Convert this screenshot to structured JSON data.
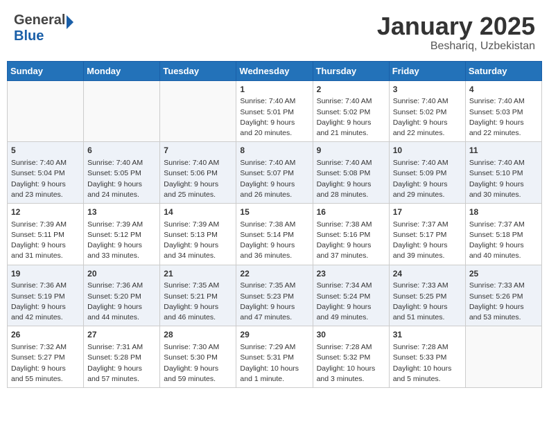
{
  "header": {
    "logo_general": "General",
    "logo_blue": "Blue",
    "month_title": "January 2025",
    "location": "Beshariq, Uzbekistan"
  },
  "calendar": {
    "weekdays": [
      "Sunday",
      "Monday",
      "Tuesday",
      "Wednesday",
      "Thursday",
      "Friday",
      "Saturday"
    ],
    "weeks": [
      [
        {
          "day": "",
          "info": ""
        },
        {
          "day": "",
          "info": ""
        },
        {
          "day": "",
          "info": ""
        },
        {
          "day": "1",
          "info": "Sunrise: 7:40 AM\nSunset: 5:01 PM\nDaylight: 9 hours\nand 20 minutes."
        },
        {
          "day": "2",
          "info": "Sunrise: 7:40 AM\nSunset: 5:02 PM\nDaylight: 9 hours\nand 21 minutes."
        },
        {
          "day": "3",
          "info": "Sunrise: 7:40 AM\nSunset: 5:02 PM\nDaylight: 9 hours\nand 22 minutes."
        },
        {
          "day": "4",
          "info": "Sunrise: 7:40 AM\nSunset: 5:03 PM\nDaylight: 9 hours\nand 22 minutes."
        }
      ],
      [
        {
          "day": "5",
          "info": "Sunrise: 7:40 AM\nSunset: 5:04 PM\nDaylight: 9 hours\nand 23 minutes."
        },
        {
          "day": "6",
          "info": "Sunrise: 7:40 AM\nSunset: 5:05 PM\nDaylight: 9 hours\nand 24 minutes."
        },
        {
          "day": "7",
          "info": "Sunrise: 7:40 AM\nSunset: 5:06 PM\nDaylight: 9 hours\nand 25 minutes."
        },
        {
          "day": "8",
          "info": "Sunrise: 7:40 AM\nSunset: 5:07 PM\nDaylight: 9 hours\nand 26 minutes."
        },
        {
          "day": "9",
          "info": "Sunrise: 7:40 AM\nSunset: 5:08 PM\nDaylight: 9 hours\nand 28 minutes."
        },
        {
          "day": "10",
          "info": "Sunrise: 7:40 AM\nSunset: 5:09 PM\nDaylight: 9 hours\nand 29 minutes."
        },
        {
          "day": "11",
          "info": "Sunrise: 7:40 AM\nSunset: 5:10 PM\nDaylight: 9 hours\nand 30 minutes."
        }
      ],
      [
        {
          "day": "12",
          "info": "Sunrise: 7:39 AM\nSunset: 5:11 PM\nDaylight: 9 hours\nand 31 minutes."
        },
        {
          "day": "13",
          "info": "Sunrise: 7:39 AM\nSunset: 5:12 PM\nDaylight: 9 hours\nand 33 minutes."
        },
        {
          "day": "14",
          "info": "Sunrise: 7:39 AM\nSunset: 5:13 PM\nDaylight: 9 hours\nand 34 minutes."
        },
        {
          "day": "15",
          "info": "Sunrise: 7:38 AM\nSunset: 5:14 PM\nDaylight: 9 hours\nand 36 minutes."
        },
        {
          "day": "16",
          "info": "Sunrise: 7:38 AM\nSunset: 5:16 PM\nDaylight: 9 hours\nand 37 minutes."
        },
        {
          "day": "17",
          "info": "Sunrise: 7:37 AM\nSunset: 5:17 PM\nDaylight: 9 hours\nand 39 minutes."
        },
        {
          "day": "18",
          "info": "Sunrise: 7:37 AM\nSunset: 5:18 PM\nDaylight: 9 hours\nand 40 minutes."
        }
      ],
      [
        {
          "day": "19",
          "info": "Sunrise: 7:36 AM\nSunset: 5:19 PM\nDaylight: 9 hours\nand 42 minutes."
        },
        {
          "day": "20",
          "info": "Sunrise: 7:36 AM\nSunset: 5:20 PM\nDaylight: 9 hours\nand 44 minutes."
        },
        {
          "day": "21",
          "info": "Sunrise: 7:35 AM\nSunset: 5:21 PM\nDaylight: 9 hours\nand 46 minutes."
        },
        {
          "day": "22",
          "info": "Sunrise: 7:35 AM\nSunset: 5:23 PM\nDaylight: 9 hours\nand 47 minutes."
        },
        {
          "day": "23",
          "info": "Sunrise: 7:34 AM\nSunset: 5:24 PM\nDaylight: 9 hours\nand 49 minutes."
        },
        {
          "day": "24",
          "info": "Sunrise: 7:33 AM\nSunset: 5:25 PM\nDaylight: 9 hours\nand 51 minutes."
        },
        {
          "day": "25",
          "info": "Sunrise: 7:33 AM\nSunset: 5:26 PM\nDaylight: 9 hours\nand 53 minutes."
        }
      ],
      [
        {
          "day": "26",
          "info": "Sunrise: 7:32 AM\nSunset: 5:27 PM\nDaylight: 9 hours\nand 55 minutes."
        },
        {
          "day": "27",
          "info": "Sunrise: 7:31 AM\nSunset: 5:28 PM\nDaylight: 9 hours\nand 57 minutes."
        },
        {
          "day": "28",
          "info": "Sunrise: 7:30 AM\nSunset: 5:30 PM\nDaylight: 9 hours\nand 59 minutes."
        },
        {
          "day": "29",
          "info": "Sunrise: 7:29 AM\nSunset: 5:31 PM\nDaylight: 10 hours\nand 1 minute."
        },
        {
          "day": "30",
          "info": "Sunrise: 7:28 AM\nSunset: 5:32 PM\nDaylight: 10 hours\nand 3 minutes."
        },
        {
          "day": "31",
          "info": "Sunrise: 7:28 AM\nSunset: 5:33 PM\nDaylight: 10 hours\nand 5 minutes."
        },
        {
          "day": "",
          "info": ""
        }
      ]
    ]
  }
}
